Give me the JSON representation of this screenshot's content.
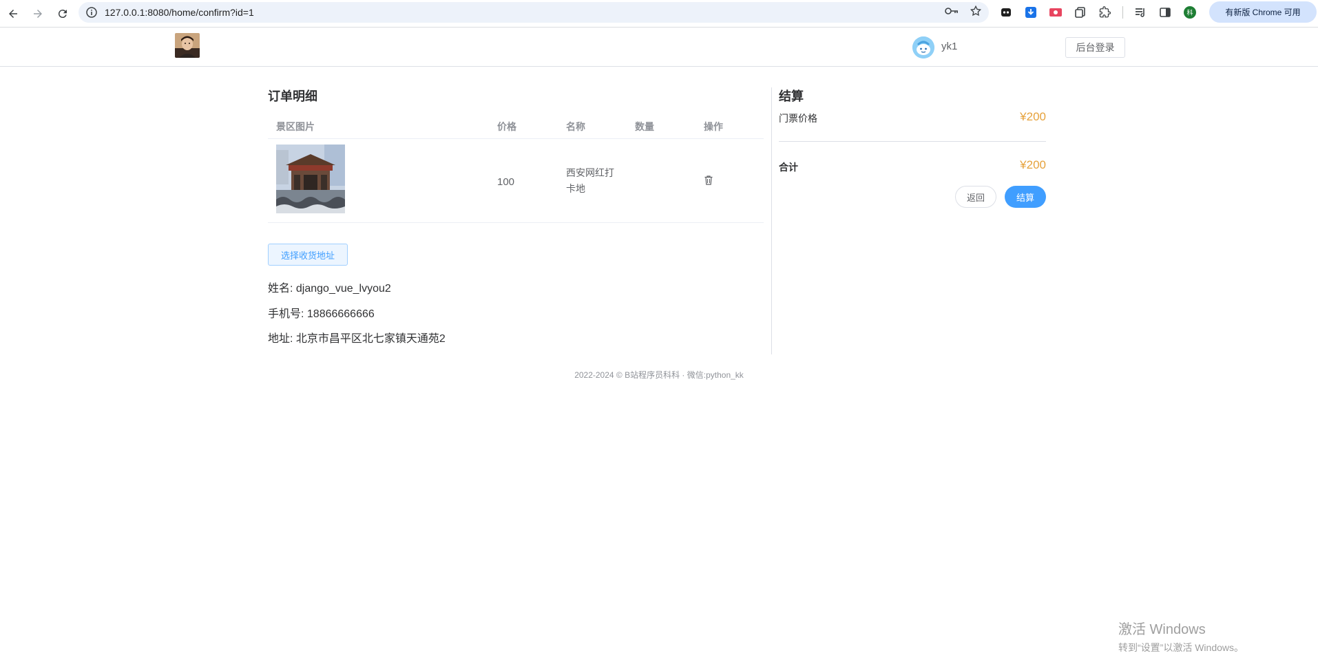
{
  "browser": {
    "url": "127.0.0.1:8080/home/confirm?id=1",
    "update_label": "有新版 Chrome 可用",
    "profile_initial": "科"
  },
  "header": {
    "username": "yk1",
    "admin_login_label": "后台登录"
  },
  "order": {
    "title": "订单明细",
    "columns": [
      "景区图片",
      "价格",
      "名称",
      "数量",
      "操作"
    ],
    "rows": [
      {
        "price": "100",
        "name": "西安网红打卡地",
        "quantity": ""
      }
    ],
    "select_address_label": "选择收货地址",
    "name_line": "姓名: django_vue_lvyou2",
    "phone_line": "手机号: 18866666666",
    "address_line": "地址: 北京市昌平区北七家镇天通苑2"
  },
  "settle": {
    "title": "结算",
    "ticket_price_label": "门票价格",
    "ticket_price_value": "¥200",
    "total_label": "合计",
    "total_value": "¥200",
    "back_label": "返回",
    "pay_label": "结算"
  },
  "footer": {
    "text": "2022-2024 © B站程序员科科 · 微信:python_kk"
  },
  "watermark": {
    "line1": "激活 Windows",
    "line2": "转到“设置”以激活 Windows。"
  },
  "colors": {
    "accent": "#409eff",
    "price": "#e6a23c",
    "divider": "#dcdfe6"
  }
}
